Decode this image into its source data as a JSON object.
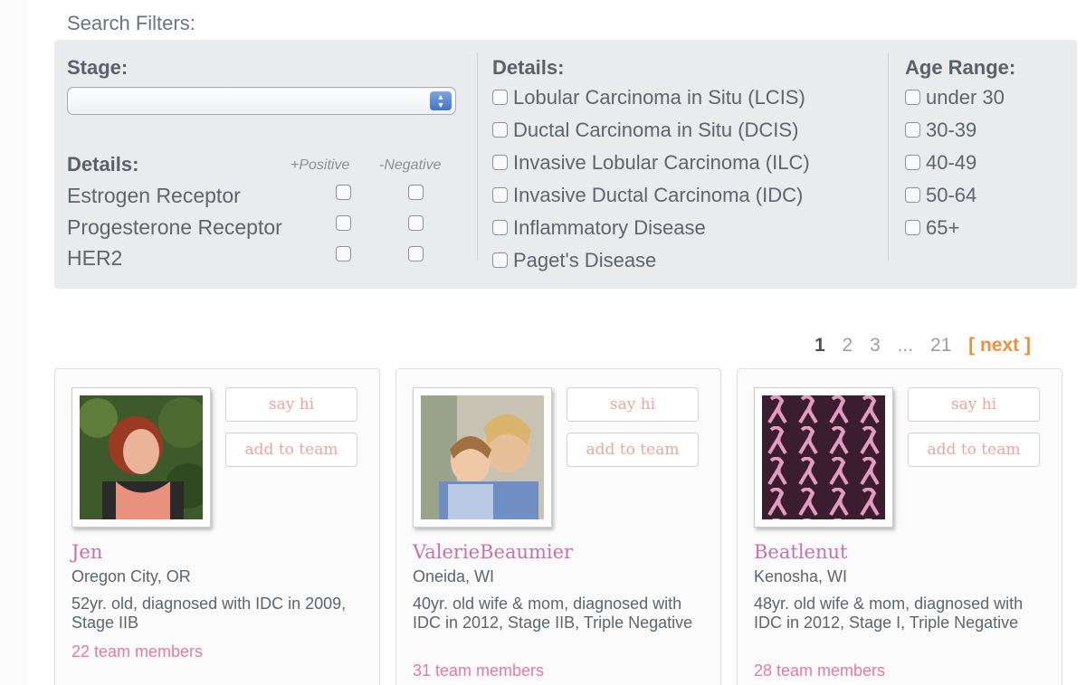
{
  "filters": {
    "title": "Search Filters:",
    "stage": {
      "label": "Stage:",
      "selected": ""
    },
    "receptors": {
      "label": "Details:",
      "positive_label": "+Positive",
      "negative_label": "-Negative",
      "rows": [
        {
          "label": "Estrogen Receptor"
        },
        {
          "label": "Progesterone Receptor"
        },
        {
          "label": "HER2"
        }
      ]
    },
    "details": {
      "label": "Details:",
      "options": [
        "Lobular Carcinoma in Situ (LCIS)",
        "Ductal Carcinoma in Situ (DCIS)",
        "Invasive Lobular Carcinoma (ILC)",
        "Invasive Ductal Carcinoma (IDC)",
        "Inflammatory Disease",
        "Paget's Disease"
      ]
    },
    "age": {
      "label": "Age Range:",
      "options": [
        "under 30",
        "30-39",
        "40-49",
        "50-64",
        "65+"
      ]
    }
  },
  "pagination": {
    "pages": [
      "1",
      "2",
      "3",
      "...",
      "21"
    ],
    "current": "1",
    "next_label": "[ next ]"
  },
  "buttons": {
    "say_hi": "say hi",
    "add_to_team": "add to team"
  },
  "profiles": [
    {
      "name": "Jen",
      "location": "Oregon City, OR",
      "description": "52yr. old, diagnosed with IDC in 2009, Stage IIB",
      "members": "22 team members"
    },
    {
      "name": "ValerieBeaumier",
      "location": "Oneida, WI",
      "description": "40yr. old wife & mom, diagnosed with IDC in 2012, Stage IIB, Triple Negative",
      "members": "31 team members"
    },
    {
      "name": "Beatlenut",
      "location": "Kenosha, WI",
      "description": "48yr. old wife & mom, diagnosed with IDC in 2012, Stage I, Triple Negative",
      "members": "28 team members"
    }
  ],
  "colors": {
    "accent_name": "#cc6fa8",
    "accent_members": "#e57aa0",
    "next_link": "#e8923c",
    "panel_bg": "#e9ebed"
  }
}
